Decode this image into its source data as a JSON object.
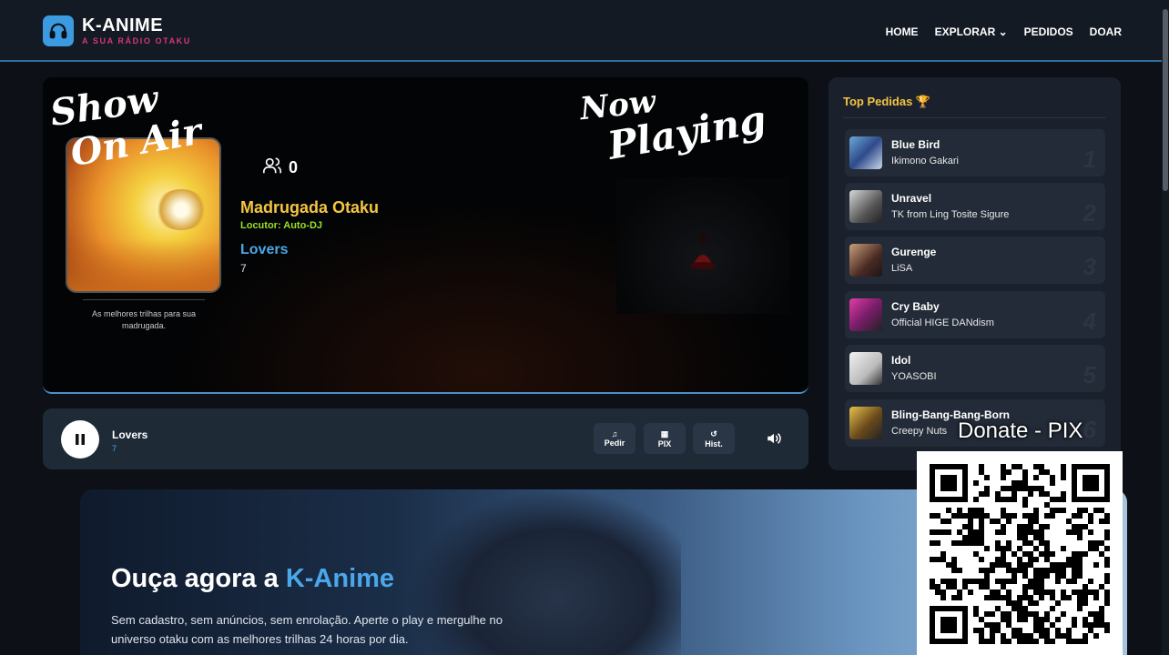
{
  "header": {
    "brand": "K-ANIME",
    "tagline": "A SUA RÁDIO OTAKU",
    "nav": [
      "HOME",
      "EXPLORAR",
      "PEDIDOS",
      "DOAR"
    ]
  },
  "hero": {
    "show_on_air_1": "Show",
    "show_on_air_2": "On Air",
    "now_playing_1": "Now",
    "now_playing_2": "Playing",
    "cover_caption": "As melhores trilhas para sua madrugada.",
    "listeners": "0",
    "program": "Madrugada Otaku",
    "dj": "Locutor: Auto-DJ",
    "song_title": "Lovers",
    "song_artist": "7"
  },
  "player": {
    "title": "Lovers",
    "artist": "7",
    "controls": [
      "Pedir",
      "PIX",
      "Hist."
    ]
  },
  "top": {
    "title": "Top Pedidas 🏆",
    "tracks": [
      {
        "title": "Blue Bird",
        "artist": "Ikimono Gakari",
        "rank": "1"
      },
      {
        "title": "Unravel",
        "artist": "TK from Ling Tosite Sigure",
        "rank": "2"
      },
      {
        "title": "Gurenge",
        "artist": "LiSA",
        "rank": "3"
      },
      {
        "title": "Cry Baby",
        "artist": "Official HIGE DANdism",
        "rank": "4"
      },
      {
        "title": "Idol",
        "artist": "YOASOBI",
        "rank": "5"
      },
      {
        "title": "Bling-Bang-Bang-Born",
        "artist": "Creepy Nuts",
        "rank": "6"
      }
    ]
  },
  "banner": {
    "title_prefix": "Ouça agora a ",
    "title_accent": "K-Anime",
    "text": "Sem cadastro, sem anúncios, sem enrolação. Aperte o play e mergulhe no universo otaku com as melhores trilhas 24 horas por dia."
  },
  "donate": {
    "label": "Donate - PIX"
  },
  "colors": {
    "accent_blue": "#4aa8ea",
    "gold": "#f4c542",
    "pink": "#d2367e",
    "green": "#9adf2a"
  }
}
